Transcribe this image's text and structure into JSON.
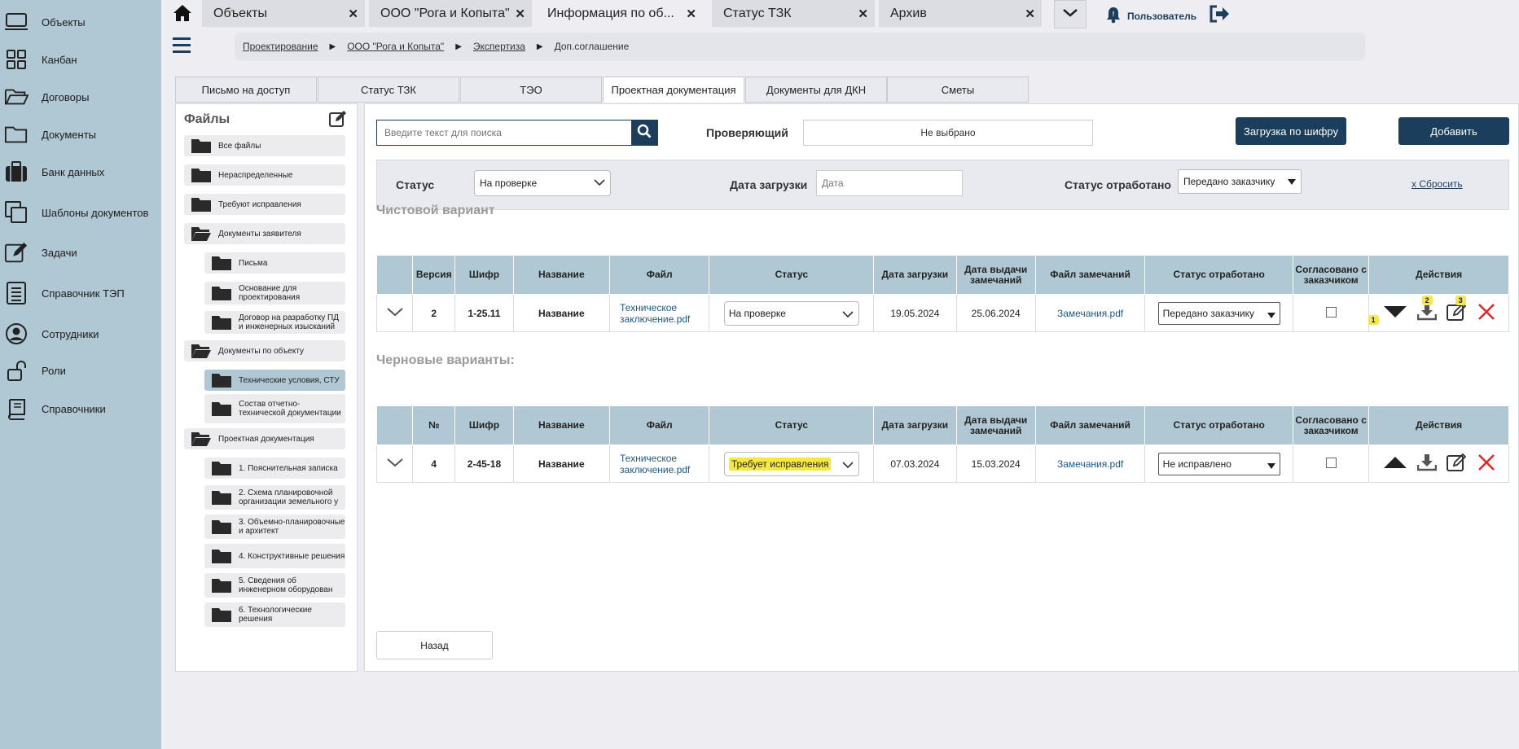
{
  "sidebar": {
    "items": [
      {
        "label": "Объекты",
        "icon": "laptop-icon"
      },
      {
        "label": "Канбан",
        "icon": "kanban-icon"
      },
      {
        "label": "Договоры",
        "icon": "folder-open-icon"
      },
      {
        "label": "Документы",
        "icon": "folder-icon"
      },
      {
        "label": "Банк данных",
        "icon": "briefcase-icon"
      },
      {
        "label": "Шаблоны документов",
        "icon": "templates-icon"
      },
      {
        "label": "Задачи",
        "icon": "edit-task-icon"
      },
      {
        "label": "Справочник ТЭП",
        "icon": "list-book-icon"
      },
      {
        "label": "Сотрудники",
        "icon": "user-circle-icon"
      },
      {
        "label": "Роли",
        "icon": "lock-icon"
      },
      {
        "label": "Справочники",
        "icon": "book-icon"
      }
    ]
  },
  "tabs": [
    {
      "label": "Объекты"
    },
    {
      "label": "ООО \"Рога и Копыта\""
    },
    {
      "label": "Информация по об..."
    },
    {
      "label": "Статус ТЗК"
    },
    {
      "label": "Архив"
    }
  ],
  "user": {
    "name": "Пользователь"
  },
  "breadcrumb": {
    "items": [
      "Проектирование",
      "ООО \"Рога и Копыта\"",
      "Экспертиза"
    ],
    "current": "Доп.соглашение"
  },
  "section_tabs": [
    "Письмо на доступ",
    "Статус ТЗК",
    "ТЭО",
    "Проектная документация",
    "Документы для ДКН",
    "Сметы"
  ],
  "files": {
    "title": "Файлы",
    "items": [
      {
        "label": "Все файлы"
      },
      {
        "label": "Нераспределенные"
      },
      {
        "label": "Требуют исправления"
      },
      {
        "label": "Документы заявителя"
      },
      {
        "label": "Письма"
      },
      {
        "label": "Основание для проектирования"
      },
      {
        "label": "Договор на разработку ПД и инженерных изысканий"
      },
      {
        "label": "Документы по объекту"
      },
      {
        "label": "Технические условия, СТУ"
      },
      {
        "label": "Состав отчетно-технической документации"
      },
      {
        "label": "Проектная документация"
      },
      {
        "label": "1. Пояснительная записка"
      },
      {
        "label": "2. Схема планировочной организации земельного у"
      },
      {
        "label": "3. Объемно-планировочные и архитект"
      },
      {
        "label": "4. Конструктивные решения"
      },
      {
        "label": "5. Сведения об инженерном оборудован"
      },
      {
        "label": "6. Технологические решения"
      }
    ]
  },
  "toolbar": {
    "search_placeholder": "Введите текст для поиска",
    "reviewer_label": "Проверяющий",
    "reviewer_value": "Не выбрано",
    "upload_button": "Загрузка по шифру",
    "add_button": "Добавить"
  },
  "filters": {
    "status_label": "Статус",
    "status_value": "На проверке",
    "date_label": "Дата загрузки",
    "date_placeholder": "Дата",
    "worked_label": "Статус отработано",
    "worked_value": "Передано заказчику",
    "reset": "х Сбросить"
  },
  "clean": {
    "title": "Чистовой вариант",
    "headers": [
      "",
      "Версия",
      "Шифр",
      "Название",
      "Файл",
      "Статус",
      "Дата загрузки",
      "Дата выдачи замечаний",
      "Файл замечаний",
      "Статус отработано",
      "Согласовано с заказчиком",
      "Действия"
    ],
    "row": {
      "version": "2",
      "code": "1-25.11",
      "name": "Название",
      "file": "Техническое заключение.pdf",
      "status": "На проверке",
      "upload_date": "19.05.2024",
      "remarks_date": "25.06.2024",
      "remarks_file": "Замечания.pdf",
      "worked": "Передано заказчику",
      "badges": [
        "1",
        "2",
        "3"
      ]
    }
  },
  "drafts": {
    "title": "Черновые варианты:",
    "headers": [
      "",
      "№",
      "Шифр",
      "Название",
      "Файл",
      "Статус",
      "Дата загрузки",
      "Дата выдачи замечаний",
      "Файл замечаний",
      "Статус отработано",
      "Согласовано с заказчиком",
      "Действия"
    ],
    "row": {
      "num": "4",
      "code": "2-45-18",
      "name": "Название",
      "file": "Техническое заключение.pdf",
      "status": "Требует исправления",
      "upload_date": "07.03.2024",
      "remarks_date": "15.03.2024",
      "remarks_file": "Замечания.pdf",
      "worked": "Не исправлено"
    }
  },
  "back_button": "Назад",
  "colors": {
    "sidebar": "#b0c8d3",
    "accent": "#1b3e5c",
    "highlight": "#f7e93b",
    "delete": "#e0262b"
  }
}
